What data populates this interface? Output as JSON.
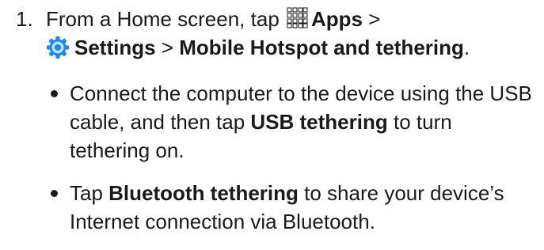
{
  "step": {
    "number": "1.",
    "line1_prefix": "From a Home screen, tap",
    "apps_label": "Apps",
    "sep1": ">",
    "settings_label": "Settings",
    "sep2": ">",
    "hotspot_label": "Mobile Hotspot and tethering",
    "period": ".",
    "apps_icon": "apps-grid-icon",
    "settings_icon": "settings-gear-icon"
  },
  "bullets": [
    {
      "pre": "Connect the computer to the device using the USB cable, and then tap ",
      "bold": "USB tethering",
      "post": " to turn tethering on."
    },
    {
      "pre": "Tap ",
      "bold": "Bluetooth tethering",
      "post": " to share your device’s Internet connection via Bluetooth."
    }
  ],
  "colors": {
    "text": "#1a1a1a",
    "settings_icon_blue": "#1e88e5"
  }
}
